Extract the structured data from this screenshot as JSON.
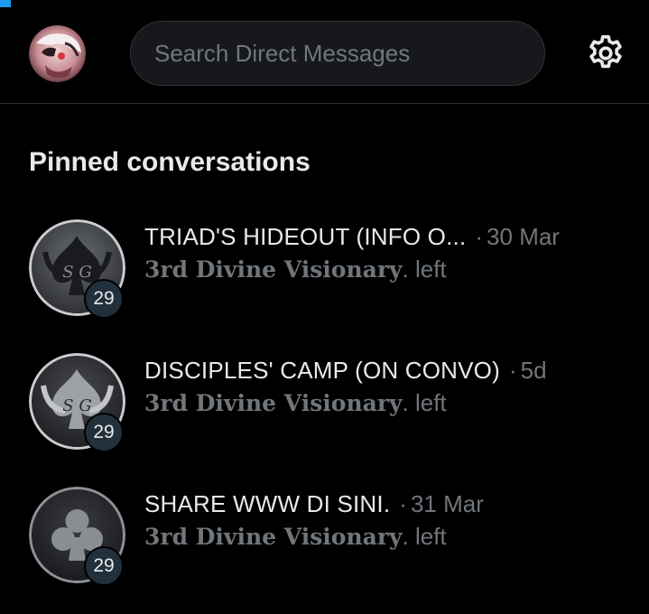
{
  "header": {
    "search_placeholder": "Search Direct Messages",
    "avatar_icon": "user-avatar",
    "settings_icon": "gear-icon"
  },
  "section": {
    "title": "Pinned conversations"
  },
  "conversations": [
    {
      "title": "TRIAD'S HIDEOUT (INFO O...",
      "separator": "·",
      "time": "30 Mar",
      "sub_name": "3rd Divine Visionary",
      "sub_suffix": ". left",
      "count": "29",
      "icon": "spade-horns-icon"
    },
    {
      "title": "DISCIPLES' CAMP (ON CONVO)",
      "separator": "·",
      "time": "5d",
      "sub_name": "3rd Divine Visionary",
      "sub_suffix": ". left",
      "count": "29",
      "icon": "spade-horns-icon"
    },
    {
      "title": "SHARE WWW DI SINI.",
      "separator": "·",
      "time": "31 Mar",
      "sub_name": "3rd Divine Visionary",
      "sub_suffix": ". left",
      "count": "29",
      "icon": "club-icon"
    }
  ],
  "colors": {
    "background": "#000000",
    "text_primary": "#e7e9ea",
    "text_secondary": "#71767b",
    "divider": "#2f3336",
    "badge": "#22303c",
    "accent": "#1d9bf0"
  }
}
